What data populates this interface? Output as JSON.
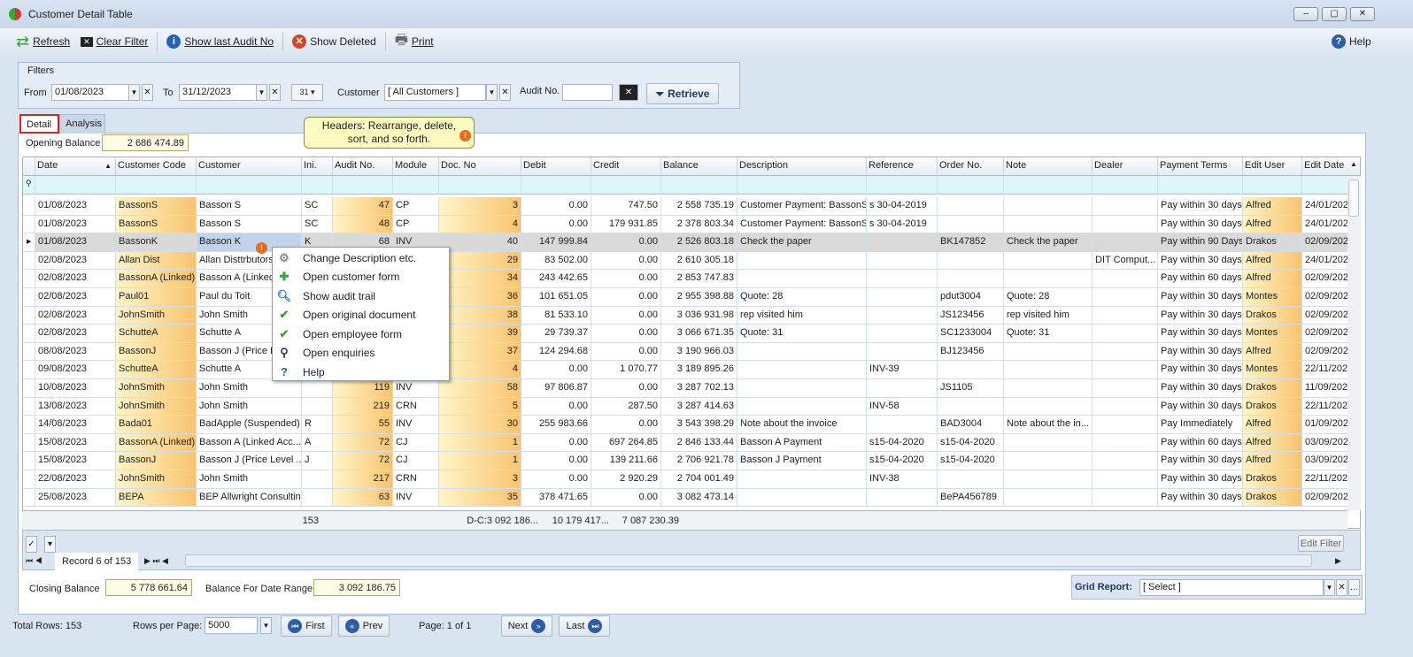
{
  "window": {
    "title": "Customer Detail Table",
    "controls": [
      "–",
      "▢",
      "✕"
    ]
  },
  "toolbar": {
    "refresh": "Refresh",
    "clear_filter": "Clear Filter",
    "show_last_audit": "Show last Audit No",
    "show_deleted": "Show Deleted",
    "print": "Print",
    "help": "Help"
  },
  "filters": {
    "title": "Filters",
    "from_label": "From",
    "from_value": "01/08/2023",
    "to_label": "To",
    "to_value": "31/12/2023",
    "calendar": "31",
    "customer_label": "Customer",
    "customer_value": "[ All Customers ]",
    "audit_label": "Audit No.",
    "audit_value": "",
    "retrieve": "Retrieve"
  },
  "tabs": [
    {
      "label": "Detail",
      "active": true
    },
    {
      "label": "Analysis",
      "active": false
    }
  ],
  "tooltip": "Headers: Rearrange, delete, sort, and so forth.",
  "opening_balance": {
    "label": "Opening Balance",
    "value": "2 686 474.89"
  },
  "grid": {
    "columns": [
      "Date",
      "Customer Code",
      "Customer",
      "Ini.",
      "Audit No.",
      "Module",
      "Doc. No",
      "Debit",
      "Credit",
      "Balance",
      "Description",
      "Reference",
      "Order No.",
      "Note",
      "Dealer",
      "Payment Terms",
      "Edit User",
      "Edit Date"
    ],
    "sort_column": "Date",
    "selected_row": 2,
    "rows": [
      [
        "01/08/2023",
        "BassonS",
        "Basson S",
        "SC",
        "47",
        "CP",
        "3",
        "0.00",
        "747.50",
        "2 558 735.19",
        "Customer Payment: BassonS",
        "s 30-04-2019",
        "",
        "",
        "",
        "Pay within 30 days",
        "Alfred",
        "24/01/202"
      ],
      [
        "01/08/2023",
        "BassonS",
        "Basson S",
        "SC",
        "48",
        "CP",
        "4",
        "0.00",
        "179 931.85",
        "2 378 803.34",
        "Customer Payment: BassonS",
        "s 30-04-2019",
        "",
        "",
        "",
        "Pay within 30 days",
        "Alfred",
        "24/01/202"
      ],
      [
        "01/08/2023",
        "BassonK",
        "Basson K",
        "K",
        "68",
        "INV",
        "40",
        "147 999.84",
        "0.00",
        "2 526 803.18",
        "Check the paper",
        "",
        "BK147852",
        "Check the paper",
        "",
        "Pay within 90 Days",
        "Drakos",
        "02/09/202"
      ],
      [
        "02/08/2023",
        "Allan Dist",
        "Allan Disttrbutors",
        "",
        "",
        "",
        "29",
        "83 502.00",
        "0.00",
        "2 610 305.18",
        "",
        "",
        "",
        "",
        "DIT Comput...",
        "Pay within 30 days",
        "Alfred",
        "24/01/202"
      ],
      [
        "02/08/2023",
        "BassonA (Linked)",
        "Basson A (Linked",
        "",
        "",
        "",
        "34",
        "243 442.65",
        "0.00",
        "2 853 747.83",
        "",
        "",
        "",
        "",
        "",
        "Pay within 60 days",
        "Alfred",
        "02/09/202"
      ],
      [
        "02/08/2023",
        "Paul01",
        "Paul du Toit",
        "",
        "",
        "",
        "36",
        "101 651.05",
        "0.00",
        "2 955 398.88",
        " Quote: 28",
        "",
        "pdut3004",
        " Quote: 28",
        "",
        "Pay within 30 days",
        "Montes",
        "02/09/202"
      ],
      [
        "02/08/2023",
        "JohnSmith",
        "John Smith",
        "",
        "",
        "",
        "38",
        "81 533.10",
        "0.00",
        "3 036 931.98",
        "rep visited him",
        "",
        "JS123456",
        "rep visited him",
        "",
        "Pay within 30 days",
        "Drakos",
        "02/09/202"
      ],
      [
        "02/08/2023",
        "SchutteA",
        "Schutte A",
        "",
        "",
        "",
        "39",
        "29 739.37",
        "0.00",
        "3 066 671.35",
        " Quote: 31",
        "",
        "SC1233004",
        " Quote: 31",
        "",
        "Pay within 30 days",
        "Montes",
        "02/09/202"
      ],
      [
        "08/08/2023",
        "BassonJ",
        "Basson J (Price Le",
        "",
        "",
        "",
        "37",
        "124 294.68",
        "0.00",
        "3 190 966.03",
        "",
        "",
        "BJ123456",
        "",
        "",
        "Pay within 30 days",
        "Alfred",
        "02/09/202"
      ],
      [
        "09/08/2023",
        "SchutteA",
        "Schutte A",
        "",
        "",
        "",
        "4",
        "0.00",
        "1 070.77",
        "3 189 895.26",
        "",
        "INV-39",
        "",
        "",
        "",
        "Pay within 30 days",
        "Montes",
        "22/11/202"
      ],
      [
        "10/08/2023",
        "JohnSmith",
        "John Smith",
        "",
        "119",
        "INV",
        "58",
        "97 806.87",
        "0.00",
        "3 287 702.13",
        "",
        "",
        "JS1105",
        "",
        "",
        "Pay within 30 days",
        "Drakos",
        "11/09/202"
      ],
      [
        "13/08/2023",
        "JohnSmith",
        "John Smith",
        "",
        "219",
        "CRN",
        "5",
        "0.00",
        "287.50",
        "3 287 414.63",
        "",
        "INV-58",
        "",
        "",
        "",
        "Pay within 30 days",
        "Drakos",
        "22/11/202"
      ],
      [
        "14/08/2023",
        "Bada01",
        "BadApple (Suspended)",
        "R",
        "55",
        "INV",
        "30",
        "255 983.66",
        "0.00",
        "3 543 398.29",
        "Note about the invoice",
        "",
        "BAD3004",
        "Note about the in...",
        "",
        "Pay Immediately",
        "Alfred",
        "01/09/202"
      ],
      [
        "15/08/2023",
        "BassonA (Linked)",
        "Basson A (Linked Acc...",
        "A",
        "72",
        "CJ",
        "1",
        "0.00",
        "697 264.85",
        "2 846 133.44",
        "Basson A Payment",
        "s15-04-2020",
        "s15-04-2020",
        "",
        "",
        "Pay within 60 days",
        "Alfred",
        "03/09/202"
      ],
      [
        "15/08/2023",
        "BassonJ",
        "Basson J (Price Level ...",
        "J",
        "72",
        "CJ",
        "1",
        "0.00",
        "139 211.66",
        "2 706 921.78",
        "Basson J Payment",
        "s15-04-2020",
        "s15-04-2020",
        "",
        "",
        "Pay within 30 days",
        "Alfred",
        "03/09/202"
      ],
      [
        "22/08/2023",
        "JohnSmith",
        "John Smith",
        "",
        "217",
        "CRN",
        "3",
        "0.00",
        "2 920.29",
        "2 704 001.49",
        "",
        "INV-38",
        "",
        "",
        "",
        "Pay within 30 days",
        "Drakos",
        "22/11/202"
      ],
      [
        "25/08/2023",
        "BEPA",
        "BEP Allwright Consulting",
        "",
        "63",
        "INV",
        "35",
        "378 471.65",
        "0.00",
        "3 082 473.14",
        "",
        "",
        "BePA456789",
        "",
        "",
        "Pay within 30 days",
        "Drakos",
        "02/09/202"
      ]
    ],
    "summary": {
      "count": "153",
      "dc": "D-C:3 092 186...",
      "debit": "10 179 417...",
      "credit": "7 087 230.39"
    }
  },
  "context_menu": [
    {
      "label": "Change Description etc.",
      "icon": "gear-icon"
    },
    {
      "label": "Open customer form",
      "icon": "plus-icon"
    },
    {
      "label": "Show audit trail",
      "icon": "search-icon"
    },
    {
      "label": "Open original document",
      "icon": "check-icon"
    },
    {
      "label": "Open employee form",
      "icon": "check-icon"
    },
    {
      "label": "Open enquiries",
      "icon": "magnifier-icon"
    },
    {
      "label": "Help",
      "icon": "help-icon"
    }
  ],
  "navigator": {
    "record": "Record 6 of 153",
    "edit_filter": "Edit Filter"
  },
  "closing_balance": {
    "label": "Closing Balance",
    "value": "5 778 661.64"
  },
  "balance_range": {
    "label": "Balance For Date Range",
    "value": "3 092 186.75"
  },
  "grid_report": {
    "label": "Grid Report:",
    "value": "[ Select ]"
  },
  "paging": {
    "total_rows": "Total Rows: 153",
    "rows_per_page_label": "Rows per Page:",
    "rows_per_page": "5000",
    "first": "First",
    "prev": "Prev",
    "page": "Page: 1 of 1",
    "next": "Next",
    "last": "Last"
  },
  "colors": {
    "accent": "#2d5ea5",
    "gradient_start": "#fff5c8",
    "gradient_end": "#f9c46f",
    "selected_row": "#d9d9d9",
    "filter_row": "#dcf6fa"
  }
}
